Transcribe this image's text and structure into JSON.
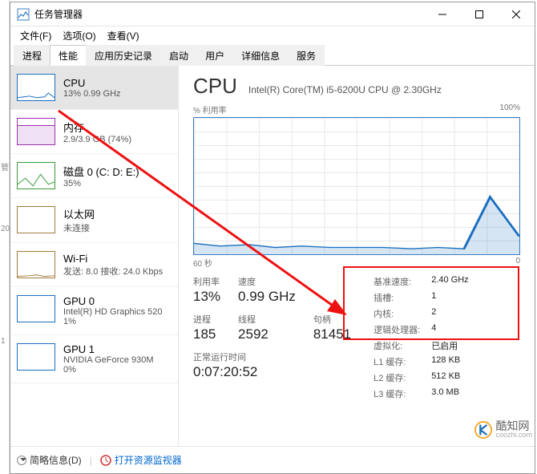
{
  "window": {
    "title": "任务管理器",
    "menus": [
      "文件(F)",
      "选项(O)",
      "查看(V)"
    ]
  },
  "tabs": [
    "进程",
    "性能",
    "应用历史记录",
    "启动",
    "用户",
    "详细信息",
    "服务"
  ],
  "active_tab": "性能",
  "sidebar": [
    {
      "name": "CPU",
      "sub": "13% 0.99 GHz",
      "kind": "cpu",
      "selected": true
    },
    {
      "name": "内存",
      "sub": "2.9/3.9 GB (74%)",
      "kind": "mem"
    },
    {
      "name": "磁盘 0 (C: D: E:)",
      "sub": "35%",
      "kind": "disk"
    },
    {
      "name": "以太网",
      "sub": "未连接",
      "kind": "eth"
    },
    {
      "name": "Wi-Fi",
      "sub": "发送: 8.0 接收: 24.0 Kbps",
      "kind": "wifi"
    },
    {
      "name": "GPU 0",
      "sub": "Intel(R) HD Graphics 520",
      "sub2": "1%",
      "kind": "gpu"
    },
    {
      "name": "GPU 1",
      "sub": "NVIDIA GeForce 930M",
      "sub2": "0%",
      "kind": "gpu"
    }
  ],
  "main": {
    "title": "CPU",
    "subtitle": "Intel(R) Core(TM) i5-6200U CPU @ 2.30GHz",
    "chart_top_left": "% 利用率",
    "chart_top_right": "100%",
    "chart_bottom_left": "60 秒",
    "chart_bottom_right": "0"
  },
  "stats_left": [
    {
      "label": "利用率",
      "value": "13%"
    },
    {
      "label": "速度",
      "value": "0.99 GHz"
    },
    {
      "label": "",
      "value": ""
    },
    {
      "label": "进程",
      "value": "185"
    },
    {
      "label": "线程",
      "value": "2592"
    },
    {
      "label": "句柄",
      "value": "81451"
    }
  ],
  "uptime": {
    "label": "正常运行时间",
    "value": "0:07:20:52"
  },
  "stats_right": [
    {
      "label": "基准速度:",
      "value": "2.40 GHz"
    },
    {
      "label": "插槽:",
      "value": "1"
    },
    {
      "label": "内核:",
      "value": "2"
    },
    {
      "label": "逻辑处理器:",
      "value": "4"
    },
    {
      "label": "虚拟化:",
      "value": "已启用"
    },
    {
      "label": "L1 缓存:",
      "value": "128 KB"
    },
    {
      "label": "L2 缓存:",
      "value": "512 KB"
    },
    {
      "label": "L3 缓存:",
      "value": "3.0 MB"
    }
  ],
  "footer": {
    "brief": "简略信息(D)",
    "resmon": "打开资源监视器"
  },
  "watermark": {
    "text": "酷知网",
    "domain": "coozhi.com"
  },
  "chart_data": {
    "type": "line",
    "title": "% 利用率",
    "xlabel": "60 秒",
    "ylabel": "% 利用率",
    "ylim": [
      0,
      100
    ],
    "x": [
      0,
      5,
      10,
      15,
      20,
      25,
      30,
      35,
      40,
      45,
      50,
      55,
      60
    ],
    "values": [
      8,
      6,
      7,
      5,
      6,
      5,
      5,
      5,
      4,
      5,
      4,
      42,
      13
    ]
  },
  "edge_labels": {
    "a": "管",
    "b": "20",
    "c": "1"
  }
}
